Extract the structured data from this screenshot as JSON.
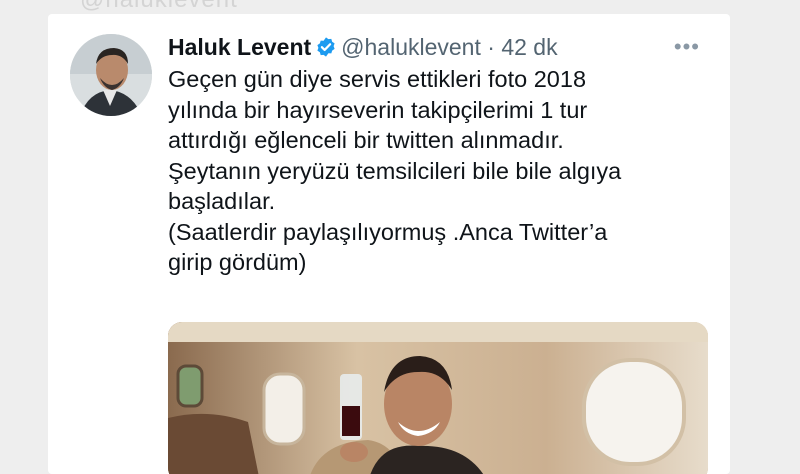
{
  "tweet": {
    "display_name": "Haluk Levent",
    "handle": "@haluklevent",
    "separator": "·",
    "time": "42 dk",
    "more_label": "•••",
    "text": "Geçen gün diye servis ettikleri foto 2018\nyılında bir hayırseverin takipçilerimi 1 tur\nattırdığı eğlenceli bir twitten alınmadır.\nŞeytanın yeryüzü temsilcileri bile bile algıya\nbaşladılar.\n(Saatlerdir paylaşılıyormuş .Anca Twitter’a\ngirip gördüm)"
  },
  "colors": {
    "verified_badge": "#1d9bf0",
    "name_text": "#0f1419",
    "secondary_text": "#536471"
  },
  "icons": {
    "verified": "verified-badge-icon",
    "more": "more-options-icon"
  }
}
